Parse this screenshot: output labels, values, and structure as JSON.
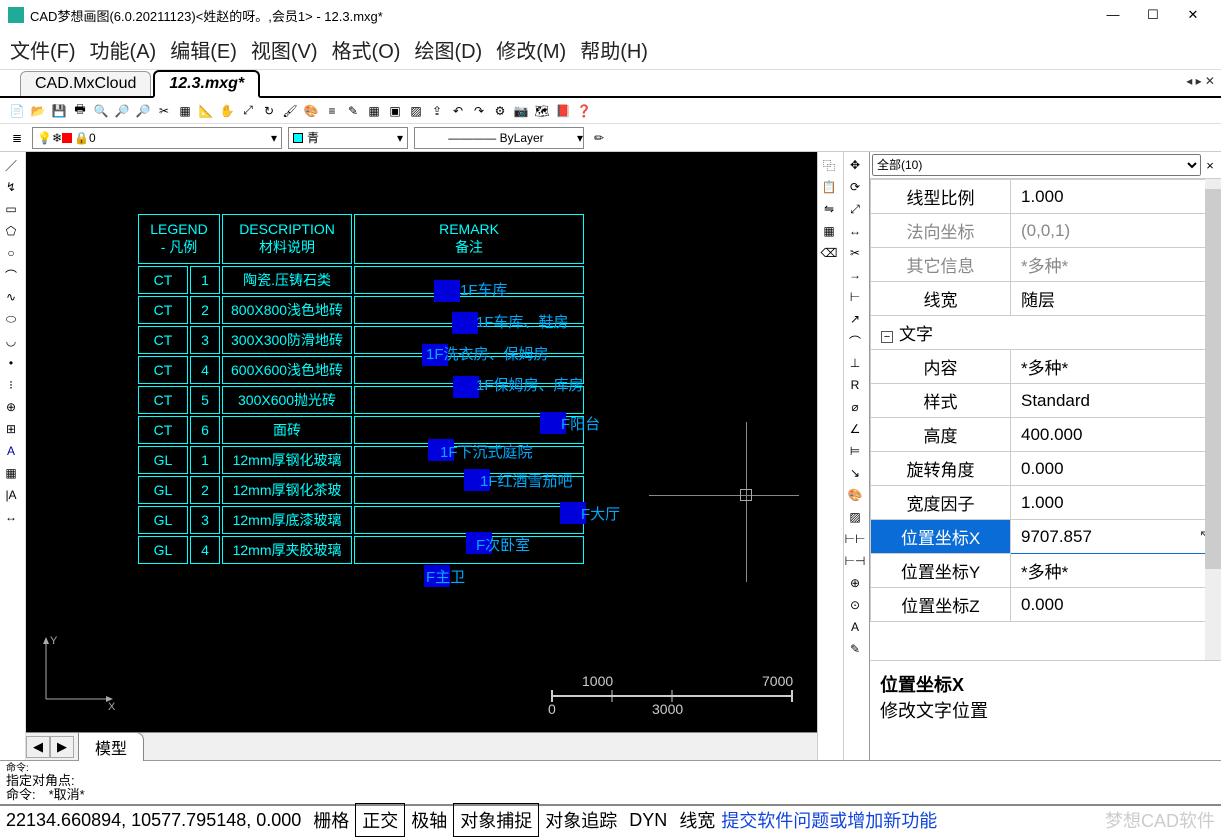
{
  "titlebar": {
    "title": "CAD梦想画图(6.0.20211123)<姓赵的呀。,会员1> - 12.3.mxg*"
  },
  "menu": {
    "file": "文件(F)",
    "func": "功能(A)",
    "edit": "编辑(E)",
    "view": "视图(V)",
    "format": "格式(O)",
    "draw": "绘图(D)",
    "modify": "修改(M)",
    "help": "帮助(H)"
  },
  "tabs": {
    "t1": "CAD.MxCloud",
    "t2": "12.3.mxg*"
  },
  "layers": {
    "layer": "0",
    "color": "青",
    "linetype": "ByLayer"
  },
  "canvas": {
    "legend_hdr": {
      "c1": "LEGEND",
      "c1b": "- 凡例",
      "c2": "DESCRIPTION",
      "c2b": "材料说明",
      "c3": "REMARK",
      "c3b": "备注"
    },
    "rows": [
      {
        "a": "CT",
        "b": "1",
        "c": "陶瓷.压铸石类",
        "r": "1F车库"
      },
      {
        "a": "CT",
        "b": "2",
        "c": "800X800浅色地砖",
        "r": "1F车库、鞋房"
      },
      {
        "a": "CT",
        "b": "3",
        "c": "300X300防滑地砖",
        "r": "1F洗衣房、保姆房"
      },
      {
        "a": "CT",
        "b": "4",
        "c": "600X600浅色地砖",
        "r": "1F保姆房、库房"
      },
      {
        "a": "CT",
        "b": "5",
        "c": "300X600抛光砖",
        "r": "F阳台"
      },
      {
        "a": "CT",
        "b": "6",
        "c": "面砖",
        "r": "1F下沉式庭院"
      },
      {
        "a": "GL",
        "b": "1",
        "c": "12mm厚钢化玻璃",
        "r": "1F红酒雪茄吧"
      },
      {
        "a": "GL",
        "b": "2",
        "c": "12mm厚钢化茶玻",
        "r": "F大厅"
      },
      {
        "a": "GL",
        "b": "3",
        "c": "12mm厚底漆玻璃",
        "r": "F次卧室"
      },
      {
        "a": "GL",
        "b": "4",
        "c": "12mm厚夹胶玻璃",
        "r": "F主卫"
      }
    ],
    "scale": {
      "a": "0",
      "b": "1000",
      "c": "3000",
      "d": "7000"
    },
    "model_tab": "模型"
  },
  "props": {
    "filter": "全部(10)",
    "rows": {
      "r1k": "线型比例",
      "r1v": "1.000",
      "r2k": "法向坐标",
      "r2v": "(0,0,1)",
      "r3k": "其它信息",
      "r3v": "*多种*",
      "r4k": "线宽",
      "r4v": "随层",
      "g1": "文字",
      "r5k": "内容",
      "r5v": "*多种*",
      "r6k": "样式",
      "r6v": "Standard",
      "r7k": "高度",
      "r7v": "400.000",
      "r8k": "旋转角度",
      "r8v": "0.000",
      "r9k": "宽度因子",
      "r9v": "1.000",
      "r10k": "位置坐标X",
      "r10v": "9707.857",
      "r11k": "位置坐标Y",
      "r11v": "*多种*",
      "r12k": "位置坐标Z",
      "r12v": "0.000"
    },
    "foot1": "位置坐标X",
    "foot2": "修改文字位置"
  },
  "cmdline": {
    "l0": "命令:",
    "l1": "指定对角点:",
    "l2": "命令:　*取消*"
  },
  "status": {
    "coords": "22134.660894, 10577.795148, 0.000",
    "b1": "栅格",
    "b2": "正交",
    "b3": "极轴",
    "b4": "对象捕捉",
    "b5": "对象追踪",
    "b6": "DYN",
    "b7": "线宽",
    "link": "提交软件问题或增加新功能",
    "wm": "梦想CAD软件"
  }
}
